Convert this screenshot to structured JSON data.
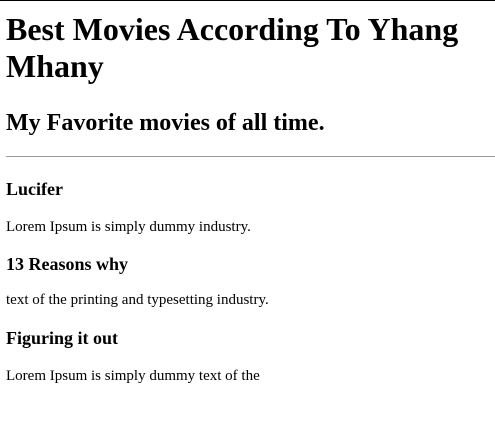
{
  "page": {
    "title": "Best Movies According To Yhang Mhany",
    "subtitle": "My Favorite movies of all time."
  },
  "movies": [
    {
      "title": "Lucifer",
      "description": "Lorem Ipsum is simply dummy industry."
    },
    {
      "title": "13 Reasons why",
      "description": "text of the printing and typesetting industry."
    },
    {
      "title": "Figuring it out",
      "description": "Lorem Ipsum is simply dummy text of the"
    }
  ]
}
